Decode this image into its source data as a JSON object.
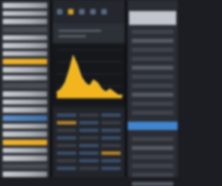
{
  "left_panel": {
    "rows": [
      "light",
      "light",
      "light",
      "dark",
      "light",
      "light",
      "light",
      "accent-yellow",
      "light",
      "light",
      "dark",
      "light",
      "light",
      "light",
      "accent-blue",
      "light",
      "light",
      "accent-yellow",
      "light",
      "light",
      "dark",
      "light"
    ]
  },
  "toolbar": {
    "icons": [
      "chart-icon",
      "amber-icon",
      "grid-icon",
      "settings-icon",
      "filter-icon"
    ]
  },
  "chart_data": {
    "type": "area",
    "x": [
      0,
      1,
      2,
      3,
      4,
      5,
      6,
      7,
      8,
      9,
      10,
      11,
      12,
      13,
      14,
      15,
      16
    ],
    "values": [
      2,
      3,
      5,
      9,
      14,
      11,
      7,
      5,
      4,
      6,
      5,
      3,
      2,
      3,
      2,
      1,
      1
    ],
    "ylim": [
      0,
      16
    ],
    "xlabel": "",
    "ylabel": "",
    "title": "",
    "grid": true,
    "fill_color": "#f2b51e",
    "line_color": "#ffd04a"
  },
  "colors": {
    "accent_yellow": "#f2b632",
    "accent_blue": "#3f85cf",
    "background": "#1b1d22"
  }
}
